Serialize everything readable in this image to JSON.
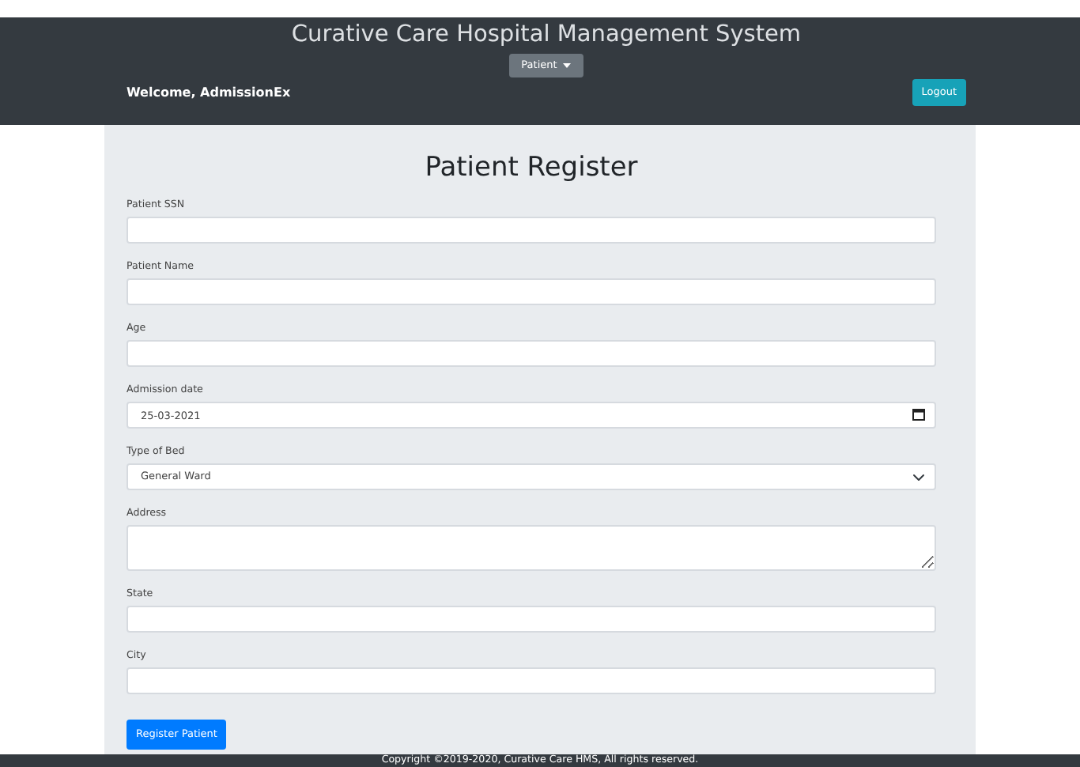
{
  "header": {
    "title": "Curative Care Hospital Management System",
    "menu_button": "Patient",
    "welcome": "Welcome, AdmissionEx",
    "logout": "Logout"
  },
  "form": {
    "title": "Patient Register",
    "fields": [
      {
        "kind": "text",
        "label": "Patient SSN"
      },
      {
        "kind": "text",
        "label": "Patient Name"
      },
      {
        "kind": "text",
        "label": "Age"
      },
      {
        "kind": "date",
        "label": "Admission date",
        "value": "25-03-2021"
      },
      {
        "kind": "select",
        "label": "Type of Bed",
        "value": "General Ward"
      },
      {
        "kind": "textarea",
        "label": "Address"
      },
      {
        "kind": "text",
        "label": "State"
      },
      {
        "kind": "text",
        "label": "City"
      }
    ],
    "submit": "Register Patient"
  },
  "footer": "Copyright ©2019-2020, Curative Care HMS, All rights reserved."
}
